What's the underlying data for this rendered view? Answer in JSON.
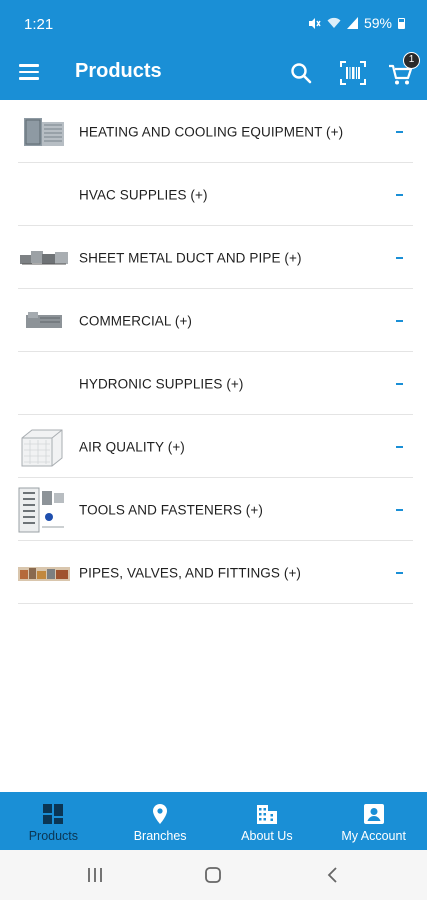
{
  "status_bar": {
    "time": "1:21",
    "battery_percent": "59%",
    "icons": [
      "mute-icon",
      "wifi-icon",
      "signal-icon",
      "battery-icon"
    ]
  },
  "app_bar": {
    "title": "Products",
    "cart_count": "1",
    "icons": [
      "menu-icon",
      "search-icon",
      "barcode-scan-icon",
      "cart-icon"
    ]
  },
  "categories": [
    {
      "label": "HEATING AND COOLING EQUIPMENT (+)",
      "thumbnail": "hvac-unit-image"
    },
    {
      "label": "HVAC SUPPLIES (+)",
      "thumbnail": ""
    },
    {
      "label": "SHEET METAL DUCT AND PIPE (+)",
      "thumbnail": "duct-pipe-image"
    },
    {
      "label": "COMMERCIAL (+)",
      "thumbnail": "commercial-unit-image"
    },
    {
      "label": "HYDRONIC SUPPLIES (+)",
      "thumbnail": ""
    },
    {
      "label": "AIR QUALITY (+)",
      "thumbnail": "air-filter-image"
    },
    {
      "label": "TOOLS AND FASTENERS (+)",
      "thumbnail": "tools-image"
    },
    {
      "label": "PIPES, VALVES, AND FITTINGS (+)",
      "thumbnail": "fittings-image"
    }
  ],
  "bottom_nav": [
    {
      "label": "Products",
      "icon": "grid-icon",
      "active": true
    },
    {
      "label": "Branches",
      "icon": "location-pin-icon",
      "active": false
    },
    {
      "label": "About Us",
      "icon": "building-icon",
      "active": false
    },
    {
      "label": "My Account",
      "icon": "account-icon",
      "active": false
    }
  ],
  "colors": {
    "primary": "#1a8fd6",
    "active_nav": "#0b3654",
    "divider": "#e4e4e4",
    "text": "#1f1f1f"
  }
}
